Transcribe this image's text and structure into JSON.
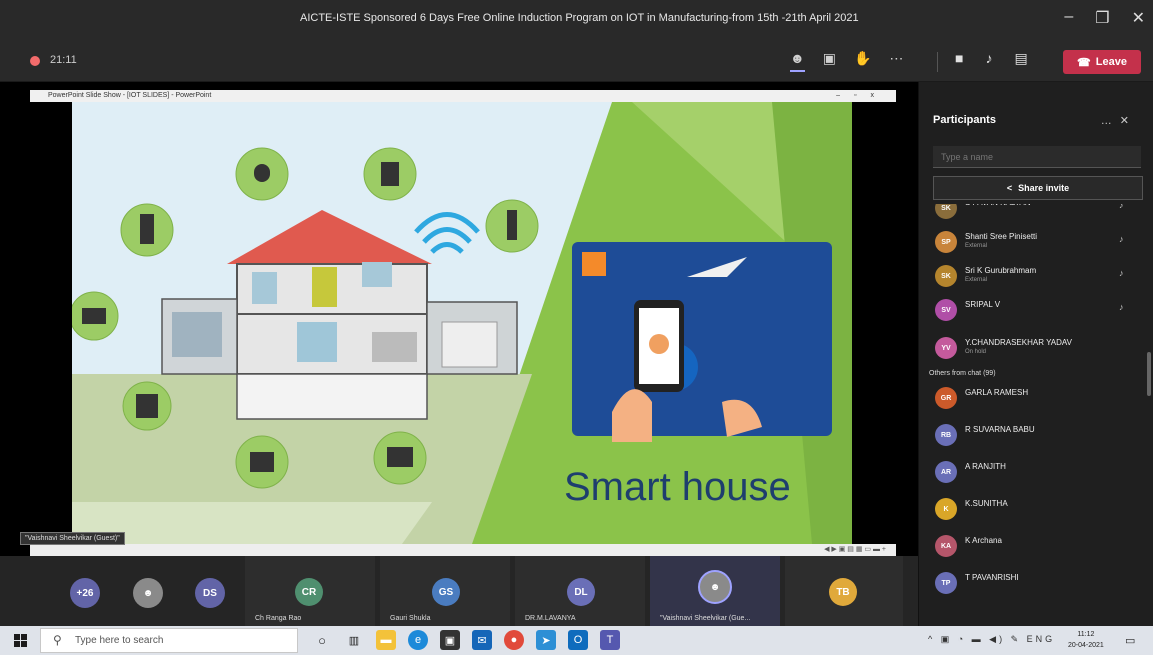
{
  "window": {
    "title": "AICTE-ISTE Sponsored 6 Days Free Online Induction Program on IOT in Manufacturing-from 15th -21th April 2021",
    "controls": [
      "–",
      "❐",
      "✕"
    ]
  },
  "toolbar": {
    "timer": "21:11",
    "leave_label": "Leave",
    "icons": [
      "people-icon",
      "chat-icon",
      "reactions-icon",
      "more-icon",
      "camera-icon",
      "mic-icon",
      "share-tray-icon"
    ]
  },
  "presentation": {
    "window_title": "PowerPoint Slide Show - [IOT SLIDES] - PowerPoint",
    "slide_title": "Smart house",
    "presenter_tag": "\"Vaishnavi Sheelvikar (Guest)\""
  },
  "strip": {
    "overflow_count": "+26",
    "initials": [
      "DS",
      "CR",
      "GS",
      "DL",
      "TB"
    ],
    "tile_names": [
      "Ch Ranga Rao",
      "Gauri Shukla",
      "DR.M.LAVANYA",
      "\"Vaishnavi Sheelvikar (Gue..."
    ]
  },
  "participants": {
    "title": "Participants",
    "search_placeholder": "Type a name",
    "share_invite": "Share invite",
    "section_others": "Others from chat (99)",
    "list": [
      {
        "initials": "SK",
        "name": "S PAVAN KALYAN",
        "sub": "",
        "color": "#8a6d3b",
        "muted": true
      },
      {
        "initials": "SP",
        "name": "Shanti Sree Pinisetti",
        "sub": "External",
        "color": "#c8843a",
        "muted": true
      },
      {
        "initials": "SK",
        "name": "Sri K Gurubrahmam",
        "sub": "External",
        "color": "#b5852d",
        "muted": true
      },
      {
        "initials": "SV",
        "name": "SRIPAL V",
        "sub": "",
        "color": "#b04ea7",
        "muted": true
      },
      {
        "initials": "YV",
        "name": "Y.CHANDRASEKHAR YADAV",
        "sub": "On hold",
        "color": "#c45a9c",
        "muted": false
      },
      {
        "initials": "GR",
        "name": "GARLA RAMESH",
        "sub": "",
        "color": "#cc5a2a",
        "muted": false
      },
      {
        "initials": "RB",
        "name": "R SUVARNA BABU",
        "sub": "",
        "color": "#6a6fb7",
        "muted": false
      },
      {
        "initials": "AR",
        "name": "A RANJITH",
        "sub": "",
        "color": "#6a6fb7",
        "muted": false
      },
      {
        "initials": "K",
        "name": "K.SUNITHA",
        "sub": "",
        "color": "#d9a628",
        "muted": false
      },
      {
        "initials": "KA",
        "name": "K Archana",
        "sub": "",
        "color": "#b5566a",
        "muted": false
      },
      {
        "initials": "TP",
        "name": "T PAVANRISHI",
        "sub": "",
        "color": "#6a6fb7",
        "muted": false
      }
    ]
  },
  "taskbar": {
    "search_placeholder": "Type here to search",
    "time": "11:12",
    "date": "20-04-2021",
    "lang": "ENG"
  },
  "colors": {
    "accent": "#6264a7",
    "leave": "#c4314b",
    "slide_green": "#7cb342",
    "slide_blue": "#1e4c97"
  }
}
